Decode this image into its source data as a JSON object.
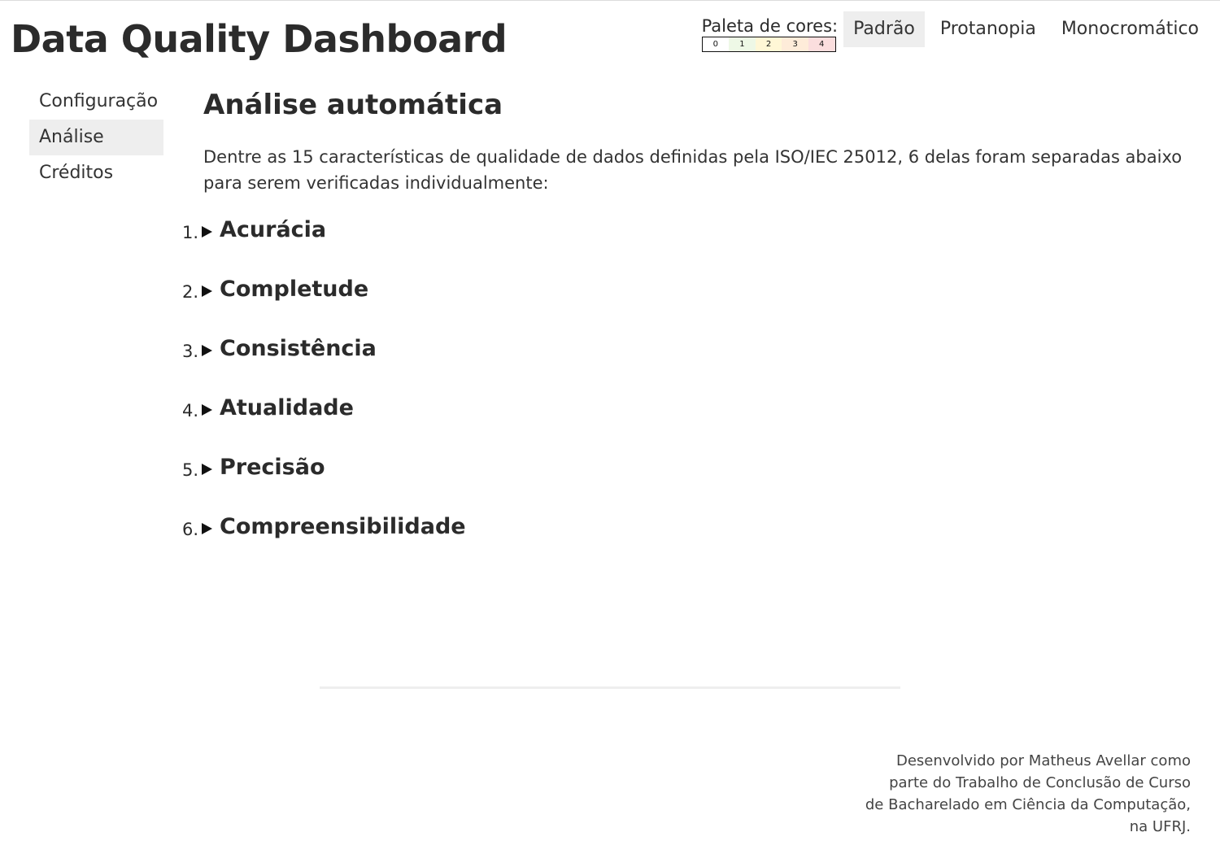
{
  "header": {
    "title": "Data Quality Dashboard"
  },
  "palette": {
    "label": "Paleta de cores:",
    "scale": [
      {
        "label": "0",
        "color": "#ffffff"
      },
      {
        "label": "1",
        "color": "#eef8e6"
      },
      {
        "label": "2",
        "color": "#fff7d6"
      },
      {
        "label": "3",
        "color": "#feecd9"
      },
      {
        "label": "4",
        "color": "#fbdede"
      }
    ],
    "options": [
      {
        "label": "Padrão",
        "active": true
      },
      {
        "label": "Protanopia",
        "active": false
      },
      {
        "label": "Monocromático",
        "active": false
      }
    ]
  },
  "sidebar": {
    "items": [
      {
        "label": "Configuração",
        "active": false
      },
      {
        "label": "Análise",
        "active": true
      },
      {
        "label": "Créditos",
        "active": false
      }
    ]
  },
  "main": {
    "title": "Análise automática",
    "intro": "Dentre as 15 características de qualidade de dados definidas pela ISO/IEC 25012, 6 delas foram separadas abaixo para serem verificadas individualmente:",
    "checks": [
      {
        "number": "1.",
        "label": "Acurácia"
      },
      {
        "number": "2.",
        "label": "Completude"
      },
      {
        "number": "3.",
        "label": "Consistência"
      },
      {
        "number": "4.",
        "label": "Atualidade"
      },
      {
        "number": "5.",
        "label": "Precisão"
      },
      {
        "number": "6.",
        "label": "Compreensibilidade"
      }
    ]
  },
  "footer": {
    "lines": [
      "Desenvolvido por Matheus Avellar como",
      "parte do Trabalho de Conclusão de Curso",
      "de Bacharelado em Ciência da Computação,",
      "na UFRJ."
    ]
  },
  "colors": {
    "text": "#2b2b2b",
    "active_bg": "#eeeeee",
    "divider": "#eeeeee"
  }
}
